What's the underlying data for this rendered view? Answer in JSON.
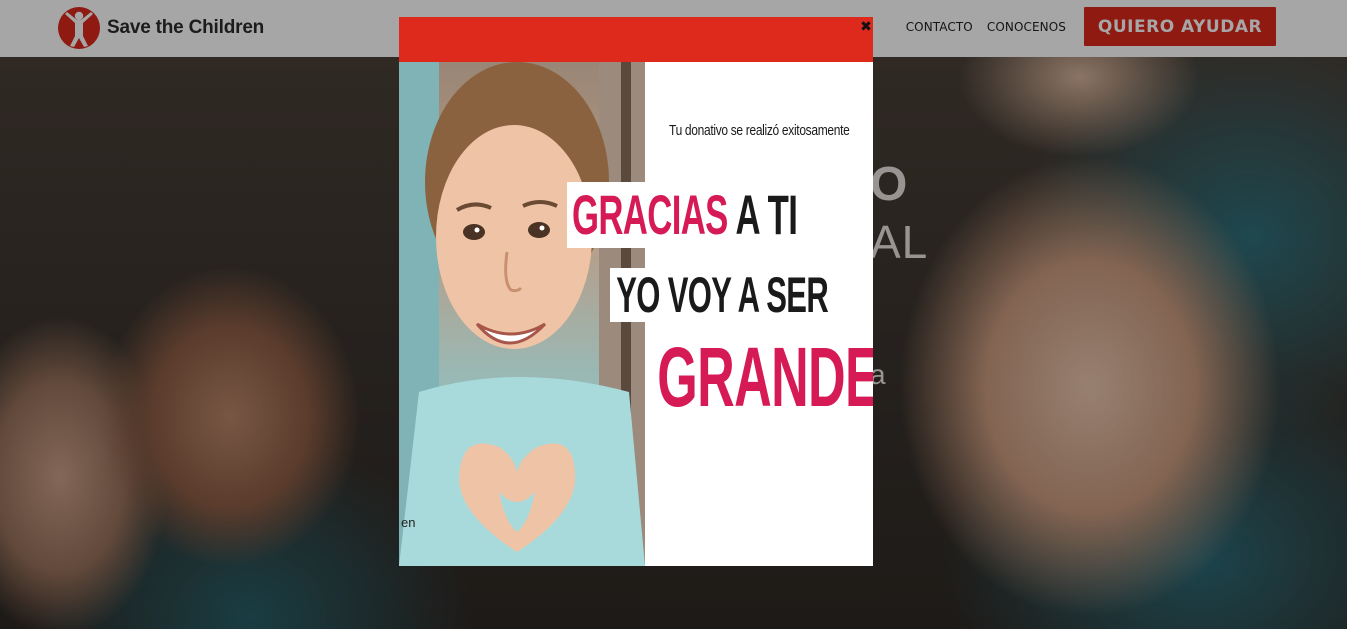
{
  "header": {
    "logo_text": "Save the Children",
    "nav": {
      "contact": "CONTACTO",
      "about": "CONOCENOS"
    },
    "cta_label": "QUIERO AYUDAR"
  },
  "hero": {
    "partial_line_1": "O",
    "partial_line_2": "AL",
    "partial_line_3": "a"
  },
  "modal": {
    "close_symbol": "✖",
    "success_message": "Tu donativo se realizó exitosamente",
    "headline_1_pink": "GRACIAS",
    "headline_1_dark": "A TI",
    "headline_2": "YO VOY A SER",
    "headline_3": "GRANDE",
    "photo_caption_fragment": "en"
  },
  "colors": {
    "brand_red": "#da291c",
    "modal_bar": "#de2a1d",
    "headline_pink": "#d61a55"
  }
}
